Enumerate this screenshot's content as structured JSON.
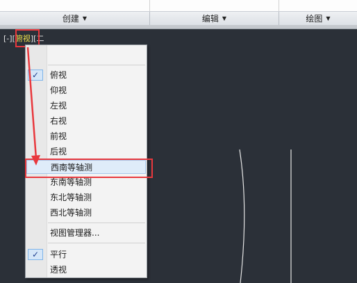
{
  "ribbon": {
    "groups": [
      {
        "label": "创建",
        "arrow": "▼"
      },
      {
        "label": "编辑",
        "arrow": "▼"
      },
      {
        "label": "绘图",
        "arrow": "▼"
      }
    ]
  },
  "viewport": {
    "controls": {
      "minus": "[-]",
      "view": "俯视",
      "style": "二"
    }
  },
  "menu": {
    "check_glyph": "✓",
    "items": [
      {
        "label": "俯视",
        "checked": true
      },
      {
        "label": "仰视"
      },
      {
        "label": "左视"
      },
      {
        "label": "右视"
      },
      {
        "label": "前视"
      },
      {
        "label": "后视"
      },
      {
        "label": "西南等轴测",
        "hover": true
      },
      {
        "label": "东南等轴测"
      },
      {
        "label": "东北等轴测"
      },
      {
        "label": "西北等轴测"
      },
      {
        "label": "视图管理器..."
      },
      {
        "label": "平行",
        "checked": true
      },
      {
        "label": "透视"
      }
    ]
  },
  "colors": {
    "annotation": "#e8383d",
    "viewport_bg": "#2b3038",
    "view_label": "#f0e14a"
  }
}
